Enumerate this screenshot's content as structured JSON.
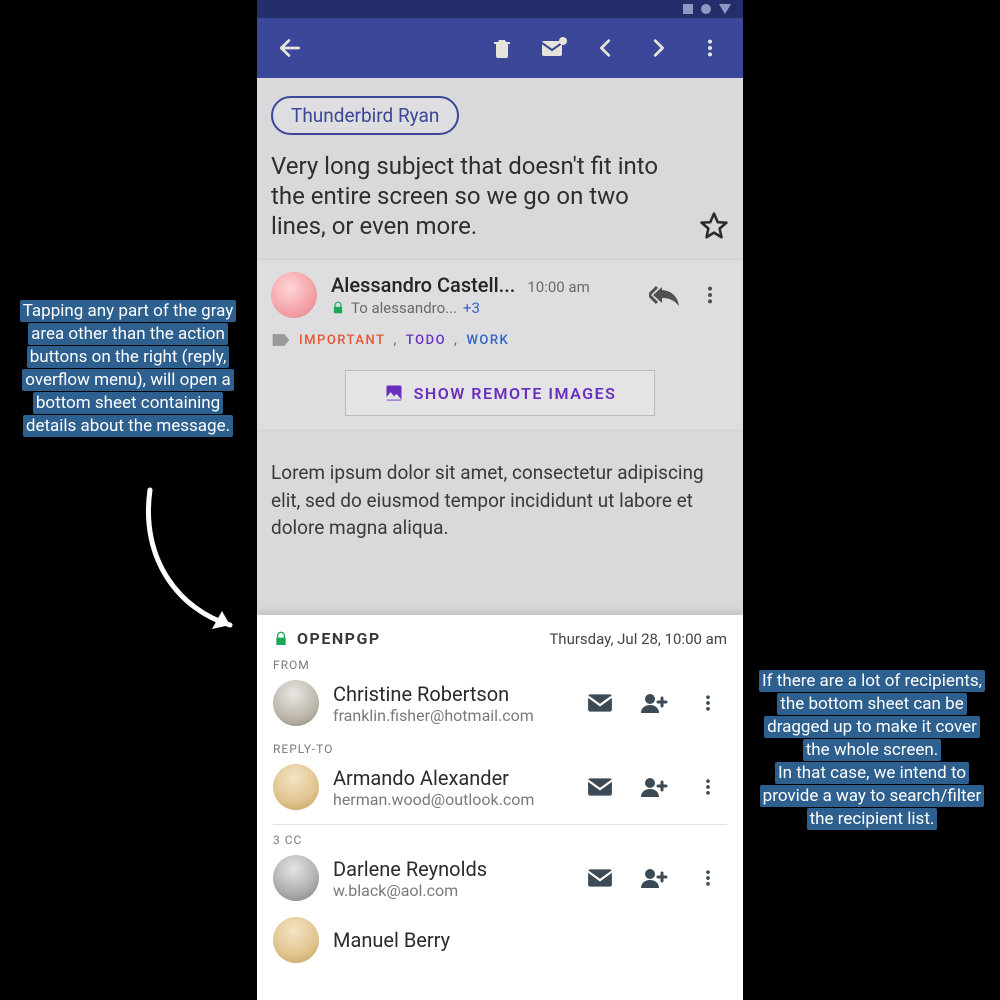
{
  "chip": "Thunderbird Ryan",
  "subject": "Very long subject that doesn't fit into the entire screen so we go on two lines, or even more.",
  "sender": {
    "name": "Alessandro Castell...",
    "time": "10:00 am",
    "to_text": "To alessandro...",
    "to_more": "+3"
  },
  "tags": {
    "important": "IMPORTANT",
    "todo": "TODO",
    "work": "WORK"
  },
  "remote_button": "SHOW REMOTE IMAGES",
  "body": "Lorem ipsum dolor sit amet, consectetur adipiscing elit, sed do eiusmod tempor incididunt ut labore et dolore magna aliqua.",
  "sheet": {
    "security": "OPENPGP",
    "date": "Thursday, Jul 28, 10:00 am",
    "from_label": "FROM",
    "replyto_label": "REPLY-TO",
    "cc_label": "3 CC",
    "from": {
      "name": "Christine Robertson",
      "email": "franklin.fisher@hotmail.com"
    },
    "reply": {
      "name": "Armando Alexander",
      "email": "herman.wood@outlook.com"
    },
    "cc1": {
      "name": "Darlene Reynolds",
      "email": "w.black@aol.com"
    },
    "cc2": {
      "name": "Manuel Berry",
      "email": ""
    }
  },
  "anno": {
    "left": "Tapping any part of the gray area other than the action buttons on the right (reply, overflow menu), will open a bottom sheet containing details about the message.",
    "right": "If there are a lot of recipients, the bottom sheet can be dragged up to make it cover the whole screen.\nIn that case, we intend to provide a way to search/filter the recipient list."
  }
}
